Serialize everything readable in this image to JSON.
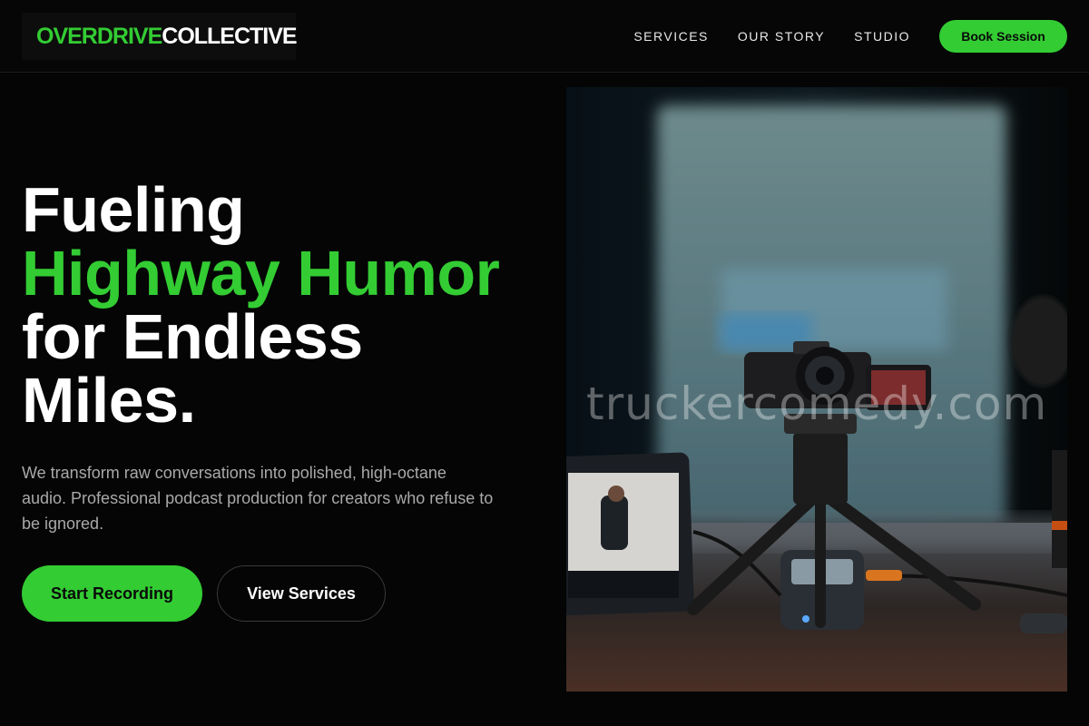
{
  "header": {
    "logo_part1": "OVERDRIVE",
    "logo_part2": "COLLECTIVE",
    "nav": [
      "SERVICES",
      "OUR STORY",
      "STUDIO"
    ],
    "cta": "Book Session"
  },
  "hero": {
    "title_line1": "Fueling",
    "title_line2": "Highway Humor",
    "title_line3": "for Endless",
    "title_line4": "Miles.",
    "subtitle": "We transform raw conversations into polished, high-octane audio. Professional podcast production for creators who refuse to be ignored.",
    "primary_button": "Start Recording",
    "secondary_button": "View Services",
    "watermark": "truckercomedy.com"
  },
  "colors": {
    "accent": "#33cc33",
    "background": "#050505",
    "text": "#ffffff",
    "muted": "#a9a9a9"
  },
  "icons": {
    "hero_image": "studio-camera-photo"
  }
}
